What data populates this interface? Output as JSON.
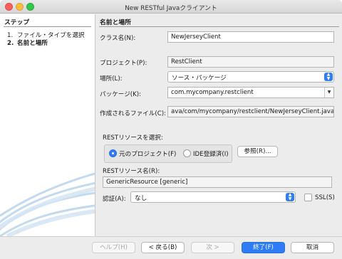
{
  "window": {
    "title": "New RESTful Javaクライアント"
  },
  "steps": {
    "heading": "ステップ",
    "items": [
      {
        "num": "1.",
        "label": "ファイル・タイプを選択",
        "current": false
      },
      {
        "num": "2.",
        "label": "名前と場所",
        "current": true
      }
    ]
  },
  "panel": {
    "heading": "名前と場所",
    "class_name": {
      "label": "クラス名(N):",
      "value": "NewJerseyClient"
    },
    "project": {
      "label": "プロジェクト(P):",
      "value": "RestClient"
    },
    "location": {
      "label": "場所(L):",
      "value": "ソース・パッケージ"
    },
    "package": {
      "label": "パッケージ(K):",
      "value": "com.mycompany.restclient"
    },
    "created_file": {
      "label": "作成されるファイル(C):",
      "value": "ava/com/mycompany/restclient/NewJerseyClient.java"
    },
    "rest_source": {
      "label": "RESTリソースを選択:",
      "options": [
        {
          "label": "元のプロジェクト(F)",
          "selected": true
        },
        {
          "label": "IDE登録済(I)",
          "selected": false
        }
      ],
      "browse_label": "参照(R)..."
    },
    "rest_resource_name": {
      "label": "RESTリソース名(R):",
      "value": "GenericResource [generic]"
    },
    "auth": {
      "label": "認証(A):",
      "value": "なし"
    },
    "ssl": {
      "label": "SSL(S)",
      "checked": false
    }
  },
  "buttons": {
    "help": "ヘルプ(H)",
    "back": "< 戻る(B)",
    "next": "次 >",
    "finish": "終了(F)",
    "cancel": "取消"
  },
  "colors": {
    "accent": "#2f7df6",
    "swoosh": "#b9d4ec"
  },
  "icons": {
    "combo_updown": "up-down-chevron-icon",
    "combo_dropdown": "dropdown-triangle-icon"
  }
}
